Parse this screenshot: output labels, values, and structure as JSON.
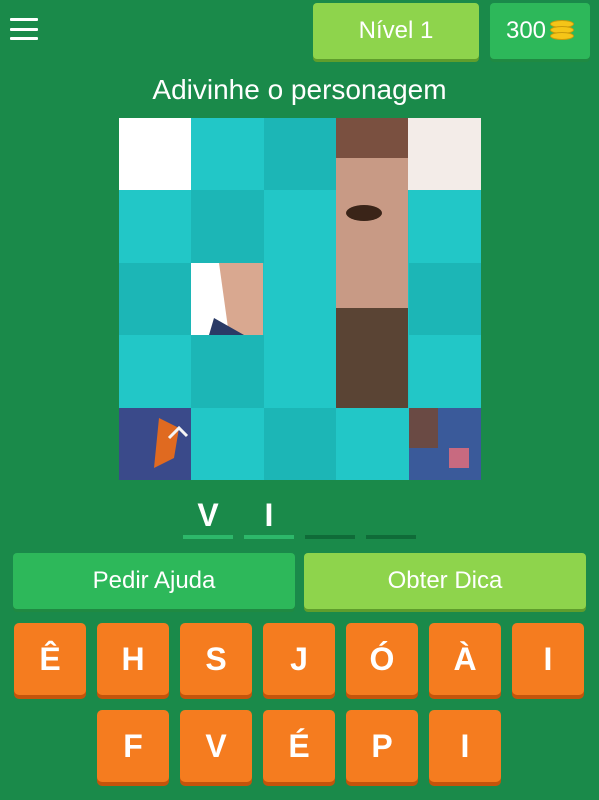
{
  "header": {
    "level_label": "Nível 1",
    "coins": "300",
    "coin_icon": "coins-icon"
  },
  "title": "Adivinhe o personagem",
  "answer": [
    {
      "letter": "V"
    },
    {
      "letter": "I"
    },
    {
      "letter": ""
    },
    {
      "letter": ""
    }
  ],
  "actions": {
    "help_label": "Pedir Ajuda",
    "hint_label": "Obter Dica"
  },
  "keyboard": {
    "row1": [
      "Ê",
      "H",
      "S",
      "J",
      "Ó",
      "À",
      "I"
    ],
    "row2": [
      "F",
      "V",
      "É",
      "P",
      "I"
    ]
  },
  "colors": {
    "background": "#1a8a4a",
    "level_button": "#8ed44c",
    "help_button": "#2db85a",
    "key": "#f57c1f",
    "tile_cover": "#22c7c7"
  }
}
